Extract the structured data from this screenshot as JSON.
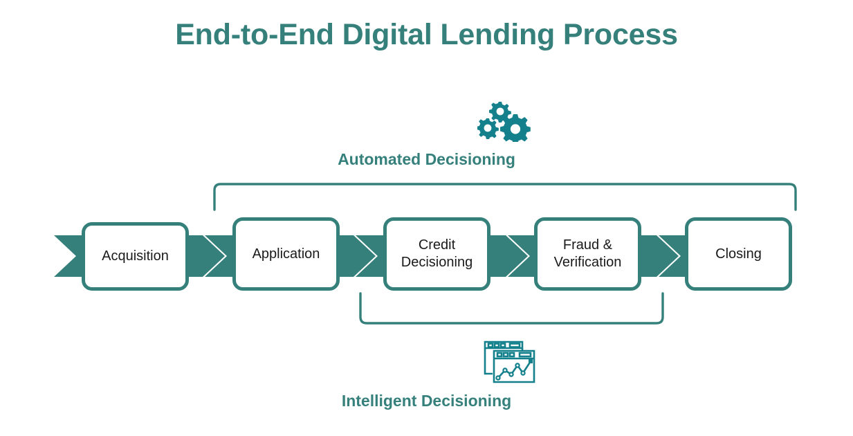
{
  "page": {
    "title": "End-to-End Digital Lending Process",
    "background": "#ffffff"
  },
  "colors": {
    "teal": "#36807c",
    "icon_teal": "#13808c",
    "box_fill": "#ffffff",
    "text": "#1a1a1a"
  },
  "chart_data": {
    "type": "diagram",
    "title": "End-to-End Digital Lending Process",
    "diagram_kind": "horizontal-chevron-process-flow",
    "stages": [
      {
        "label": "Acquisition",
        "lines": [
          "Acquisition"
        ]
      },
      {
        "label": "Application",
        "lines": [
          "Application"
        ]
      },
      {
        "label": "Credit Decisioning",
        "lines": [
          "Credit",
          "Decisioning"
        ]
      },
      {
        "label": "Fraud & Verification",
        "lines": [
          "Fraud &",
          "Verification"
        ]
      },
      {
        "label": "Closing",
        "lines": [
          "Closing"
        ]
      }
    ],
    "annotations": [
      {
        "label": "Automated Decisioning",
        "position": "above",
        "icon": "gears-icon",
        "spans_stages": [
          "Application",
          "Credit Decisioning",
          "Fraud & Verification",
          "Closing"
        ]
      },
      {
        "label": "Intelligent Decisioning",
        "position": "below",
        "icon": "dashboard-chart-icon",
        "spans_stages": [
          "Credit Decisioning",
          "Fraud & Verification"
        ]
      }
    ]
  },
  "flow": {
    "stages": [
      {
        "id": "acquisition",
        "line1": "Acquisition",
        "line2": ""
      },
      {
        "id": "application",
        "line1": "Application",
        "line2": ""
      },
      {
        "id": "credit-decisioning",
        "line1": "Credit",
        "line2": "Decisioning"
      },
      {
        "id": "fraud-verification",
        "line1": "Fraud &",
        "line2": "Verification"
      },
      {
        "id": "closing",
        "line1": "Closing",
        "line2": ""
      }
    ]
  },
  "annotations": {
    "automated": {
      "label": "Automated Decisioning",
      "icon_name": "gears-icon"
    },
    "intelligent": {
      "label": "Intelligent Decisioning",
      "icon_name": "dashboard-chart-icon"
    }
  }
}
